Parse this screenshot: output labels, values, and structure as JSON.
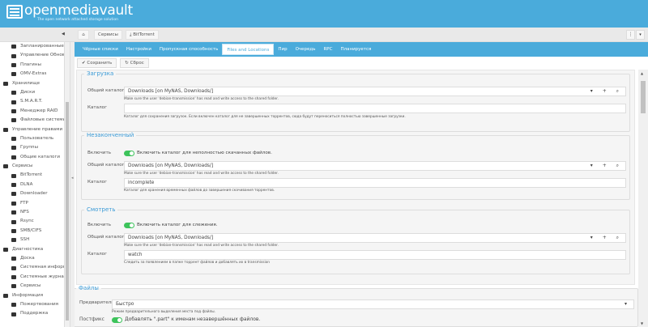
{
  "header": {
    "logo": "openmediavault",
    "tagline": "The open network attached storage solution"
  },
  "breadcrumb": {
    "home": "home",
    "items": [
      "Сервисы",
      "BitTorrent"
    ]
  },
  "sidebar": {
    "items": [
      {
        "label": "Запланированные задачи",
        "type": "sub",
        "icon": "calendar-icon"
      },
      {
        "label": "Управление Обновлениями",
        "type": "sub",
        "icon": "refresh-icon"
      },
      {
        "label": "Плагины",
        "type": "sub",
        "icon": "plugin-icon"
      },
      {
        "label": "OMV-Extras",
        "type": "sub",
        "icon": "extras-icon"
      },
      {
        "label": "Хранилище",
        "type": "cat",
        "icon": "storage-icon"
      },
      {
        "label": "Диски",
        "type": "sub",
        "icon": "disk-icon"
      },
      {
        "label": "S.M.A.R.T.",
        "type": "sub",
        "icon": "pulse-icon"
      },
      {
        "label": "Менеджер RAID",
        "type": "sub",
        "icon": "raid-icon"
      },
      {
        "label": "Файловые системы",
        "type": "sub",
        "icon": "folder-icon"
      },
      {
        "label": "Управление правами доступа",
        "type": "cat",
        "icon": "access-icon"
      },
      {
        "label": "Пользователь",
        "type": "sub",
        "icon": "user-icon"
      },
      {
        "label": "Группы",
        "type": "sub",
        "icon": "group-icon"
      },
      {
        "label": "Общие каталоги",
        "type": "sub",
        "icon": "share-icon"
      },
      {
        "label": "Сервисы",
        "type": "cat",
        "icon": "services-icon"
      },
      {
        "label": "BitTorrent",
        "type": "sub",
        "icon": "download-icon"
      },
      {
        "label": "DLNA",
        "type": "sub",
        "icon": "dlna-icon"
      },
      {
        "label": "Downloader",
        "type": "sub",
        "icon": "downloader-icon"
      },
      {
        "label": "FTP",
        "type": "sub",
        "icon": "ftp-icon"
      },
      {
        "label": "NFS",
        "type": "sub",
        "icon": "nfs-icon"
      },
      {
        "label": "Rsync",
        "type": "sub",
        "icon": "rsync-icon"
      },
      {
        "label": "SMB/CIFS",
        "type": "sub",
        "icon": "windows-icon"
      },
      {
        "label": "SSH",
        "type": "sub",
        "icon": "terminal-icon"
      },
      {
        "label": "Диагностика",
        "type": "cat",
        "icon": "diagnostics-icon"
      },
      {
        "label": "Доска",
        "type": "sub",
        "icon": "dashboard-icon"
      },
      {
        "label": "Системная информация",
        "type": "sub",
        "icon": "info-icon"
      },
      {
        "label": "Системные журналы",
        "type": "sub",
        "icon": "log-icon"
      },
      {
        "label": "Сервисы",
        "type": "sub",
        "icon": "wrench-icon"
      },
      {
        "label": "Информация",
        "type": "cat",
        "icon": "information-icon"
      },
      {
        "label": "Пожертвования",
        "type": "sub",
        "icon": "heart-icon"
      },
      {
        "label": "Поддержка",
        "type": "sub",
        "icon": "support-icon"
      }
    ]
  },
  "tabs": [
    "Чёрные списки",
    "Настройки",
    "Пропускная способность",
    "Files and Locations",
    "Пир",
    "Очередь",
    "RPC",
    "Планируется"
  ],
  "active_tab": "Files and Locations",
  "toolbar": {
    "save": "Сохранить",
    "reset": "Сброс"
  },
  "share_hint": "Make sure the user 'debian-transmission' has read and write access to the shared folder.",
  "download": {
    "legend": "Загрузка",
    "shared_label": "Общий каталог",
    "shared_value": "Downloads [on MyNAS, Downloads/]",
    "dir_label": "Каталог",
    "dir_value": "",
    "dir_hint": "Каталог для сохранения загрузок. Если включен каталог для не завершенных торрентов, сюда будут переноситься полностью завершенные загрузки."
  },
  "incomplete": {
    "legend": "Незаконченный",
    "enable_label": "Включить",
    "enable_text": "Включить каталог для неполностью скачанных файлов.",
    "enabled": true,
    "shared_label": "Общий каталог",
    "shared_value": "Downloads [on MyNAS, Downloads/]",
    "dir_label": "Каталог",
    "dir_value": "incomplete",
    "dir_hint": "Каталог для хранения временных файлов до завершения скачивания торрентов."
  },
  "watch": {
    "legend": "Смотреть",
    "enable_label": "Включить",
    "enable_text": "Включить каталог для слежения.",
    "enabled": true,
    "shared_label": "Общий каталог",
    "shared_value": "Downloads [on MyNAS, Downloads/]",
    "dir_label": "Каталог",
    "dir_value": "watch",
    "dir_hint": "Следить за появлением в папке торрент файлов и добавлять их в transmission"
  },
  "files": {
    "legend": "Файлы",
    "prealloc_label": "Предварительное выделение",
    "prealloc_value": "Быстро",
    "prealloc_hint": "Режим предварительного выделения места под файлы.",
    "postfix_label": "Постфикс",
    "postfix_text": "Добавлять \".part\" к именам незавершённых файлов.",
    "postfix_enabled": true
  }
}
